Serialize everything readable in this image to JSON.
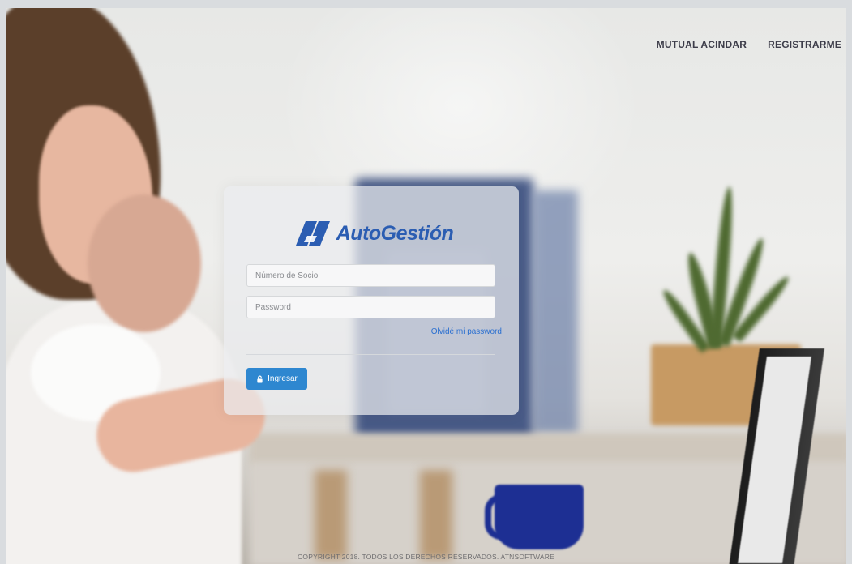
{
  "nav": {
    "items": [
      {
        "label": "MUTUAL ACINDAR"
      },
      {
        "label": "REGISTRARME"
      }
    ]
  },
  "logo": {
    "text": "AutoGestión",
    "color": "#2b5db2"
  },
  "form": {
    "socio_placeholder": "Número de Socio",
    "socio_value": "",
    "password_placeholder": "Password",
    "password_value": "",
    "forgot_label": "Olvidé mi password",
    "submit_label": "Ingresar",
    "submit_icon": "lock-icon",
    "accent": "#2e87d0"
  },
  "footer": {
    "text": "COPYRIGHT 2018. TODOS LOS DERECHOS RESERVADOS. ATNSOFTWARE"
  }
}
